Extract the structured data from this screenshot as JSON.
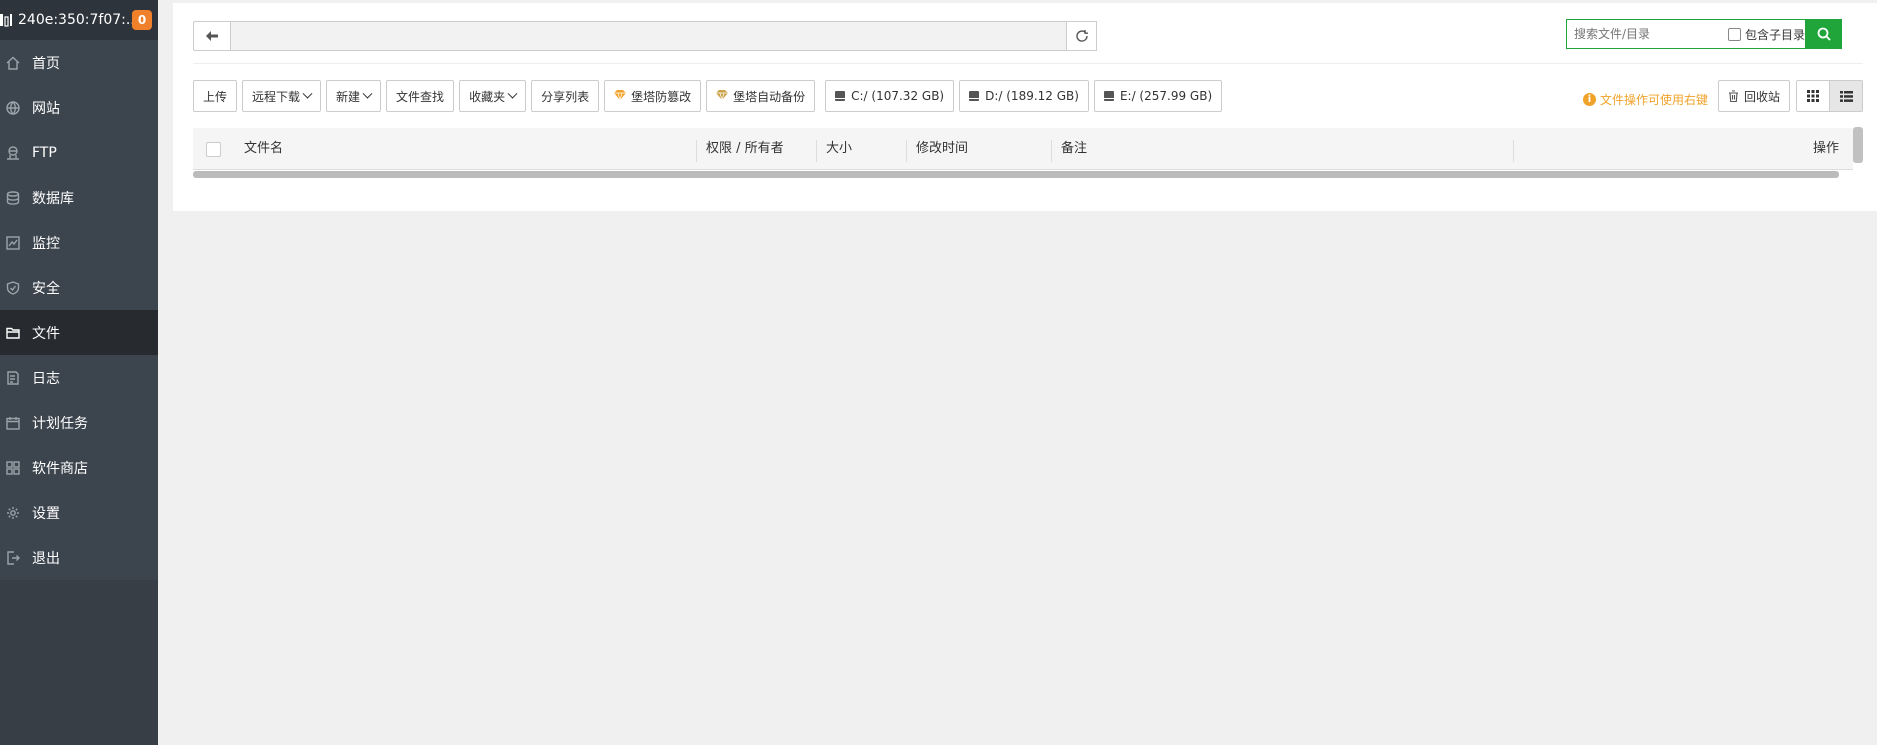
{
  "sidebar": {
    "server_name": "240e:350:7f07:...",
    "badge_count": "0",
    "items": [
      {
        "label": "首页",
        "icon": "home-icon"
      },
      {
        "label": "网站",
        "icon": "globe-icon"
      },
      {
        "label": "FTP",
        "icon": "ftp-icon"
      },
      {
        "label": "数据库",
        "icon": "database-icon"
      },
      {
        "label": "监控",
        "icon": "monitor-icon"
      },
      {
        "label": "安全",
        "icon": "shield-icon"
      },
      {
        "label": "文件",
        "icon": "folder-icon",
        "active": true
      },
      {
        "label": "日志",
        "icon": "log-icon"
      },
      {
        "label": "计划任务",
        "icon": "calendar-icon"
      },
      {
        "label": "软件商店",
        "icon": "apps-icon"
      },
      {
        "label": "设置",
        "icon": "gear-icon"
      },
      {
        "label": "退出",
        "icon": "logout-icon"
      }
    ]
  },
  "path_bar": {
    "path_value": ""
  },
  "search": {
    "placeholder": "搜索文件/目录",
    "include_subdir_label": "包含子目录"
  },
  "toolbar": {
    "upload": "上传",
    "remote_download": "远程下载",
    "new": "新建",
    "file_search": "文件查找",
    "favorites": "收藏夹",
    "share_list": "分享列表",
    "tamper_proof": "堡塔防篡改",
    "auto_backup": "堡塔自动备份",
    "disks": [
      {
        "label": "C:/ (107.32 GB)"
      },
      {
        "label": "D:/ (189.12 GB)"
      },
      {
        "label": "E:/ (257.99 GB)"
      }
    ],
    "hint": "文件操作可使用右键",
    "recycle_bin": "回收站"
  },
  "table": {
    "headers": {
      "name": "文件名",
      "permission": "权限 / 所有者",
      "size": "大小",
      "mtime": "修改时间",
      "remark": "备注",
      "action": "操作"
    }
  },
  "colors": {
    "accent_green": "#20a53a",
    "badge_orange": "#f0812a",
    "hint_orange": "#f0a32a",
    "sidebar_bg": "#3c444d"
  }
}
